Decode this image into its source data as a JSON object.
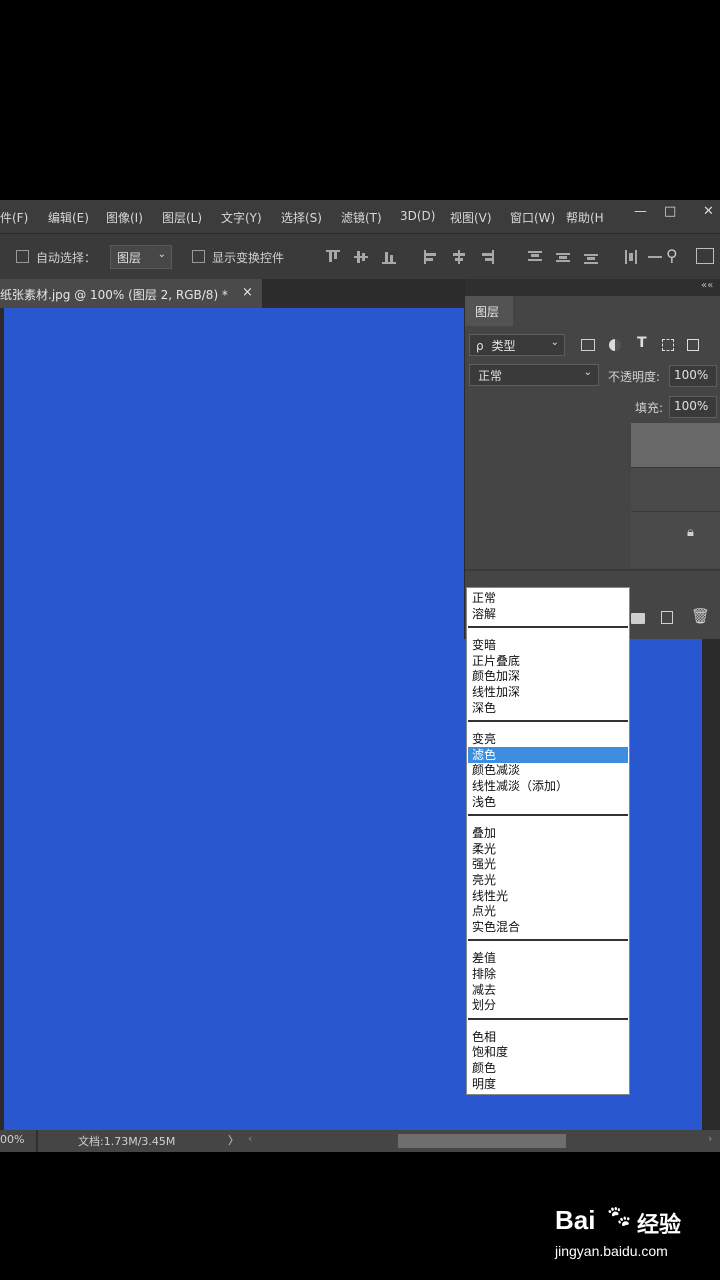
{
  "menu": [
    "件(F)",
    "编辑(E)",
    "图像(I)",
    "图层(L)",
    "文字(Y)",
    "选择(S)",
    "滤镜(T)",
    "3D(D)",
    "视图(V)",
    "窗口(W)",
    "帮助(H"
  ],
  "window_controls": {
    "minimize": "—",
    "maximize": "□",
    "close": "✕"
  },
  "options_bar": {
    "auto_select_label": "自动选择：",
    "auto_select_value": "图层",
    "show_transform_label": "显示变换控件"
  },
  "document_tab": {
    "title": "纸张素材.jpg @ 100% (图层 2, RGB/8) *",
    "close": "×"
  },
  "status_bar": {
    "zoom": "00%",
    "doc_info": "文档:1.73M/3.45M",
    "arrow": "〉",
    "scroll_left": "‹",
    "scroll_right": "›"
  },
  "layers_panel": {
    "title": "图层",
    "collapse": "««",
    "filter_label": "类型",
    "filter_icon_label": "ρ",
    "blend_mode": "正常",
    "opacity_label": "不透明度:",
    "opacity_value": "100%",
    "fill_label": "填充:",
    "fill_value": "100%"
  },
  "blend_groups": [
    [
      "正常",
      "溶解"
    ],
    [
      "变暗",
      "正片叠底",
      "颜色加深",
      "线性加深",
      "深色"
    ],
    [
      "变亮",
      "滤色",
      "颜色减淡",
      "线性减淡（添加）",
      "浅色"
    ],
    [
      "叠加",
      "柔光",
      "强光",
      "亮光",
      "线性光",
      "点光",
      "实色混合"
    ],
    [
      "差值",
      "排除",
      "减去",
      "划分"
    ],
    [
      "色相",
      "饱和度",
      "颜色",
      "明度"
    ]
  ],
  "highlighted_option": "滤色",
  "watermark": {
    "brand": "Bai",
    "brand_suffix": "经验",
    "url": "jingyan.baidu.com"
  },
  "colors": {
    "canvas": "#2857cf",
    "highlight": "#3d8ee0",
    "chrome": "#3c3c3c"
  }
}
